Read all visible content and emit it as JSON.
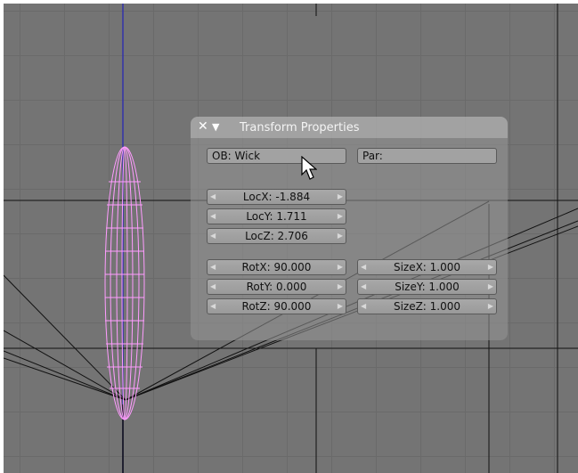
{
  "panel": {
    "title": "Transform Properties",
    "close_glyph": "✕",
    "collapse_glyph": "▼",
    "object_field": "OB: Wick",
    "parent_field": "Par:"
  },
  "location": {
    "x": "LocX: -1.884",
    "y": "LocY: 1.711",
    "z": "LocZ: 2.706"
  },
  "rotation": {
    "x": "RotX: 90.000",
    "y": "RotY: 0.000",
    "z": "RotZ: 90.000"
  },
  "size": {
    "x": "SizeX: 1.000",
    "y": "SizeY: 1.000",
    "z": "SizeZ: 1.000"
  },
  "colors": {
    "viewport_bg": "#747474",
    "grid": "#6a6a6a",
    "selected_wire": "#ff9cff",
    "z_axis": "#3333aa"
  },
  "icons": {
    "close": "close-icon",
    "collapse": "triangle-down-icon",
    "left_arrow": "arrow-left-icon",
    "right_arrow": "arrow-right-icon",
    "cursor": "mouse-pointer-icon"
  }
}
